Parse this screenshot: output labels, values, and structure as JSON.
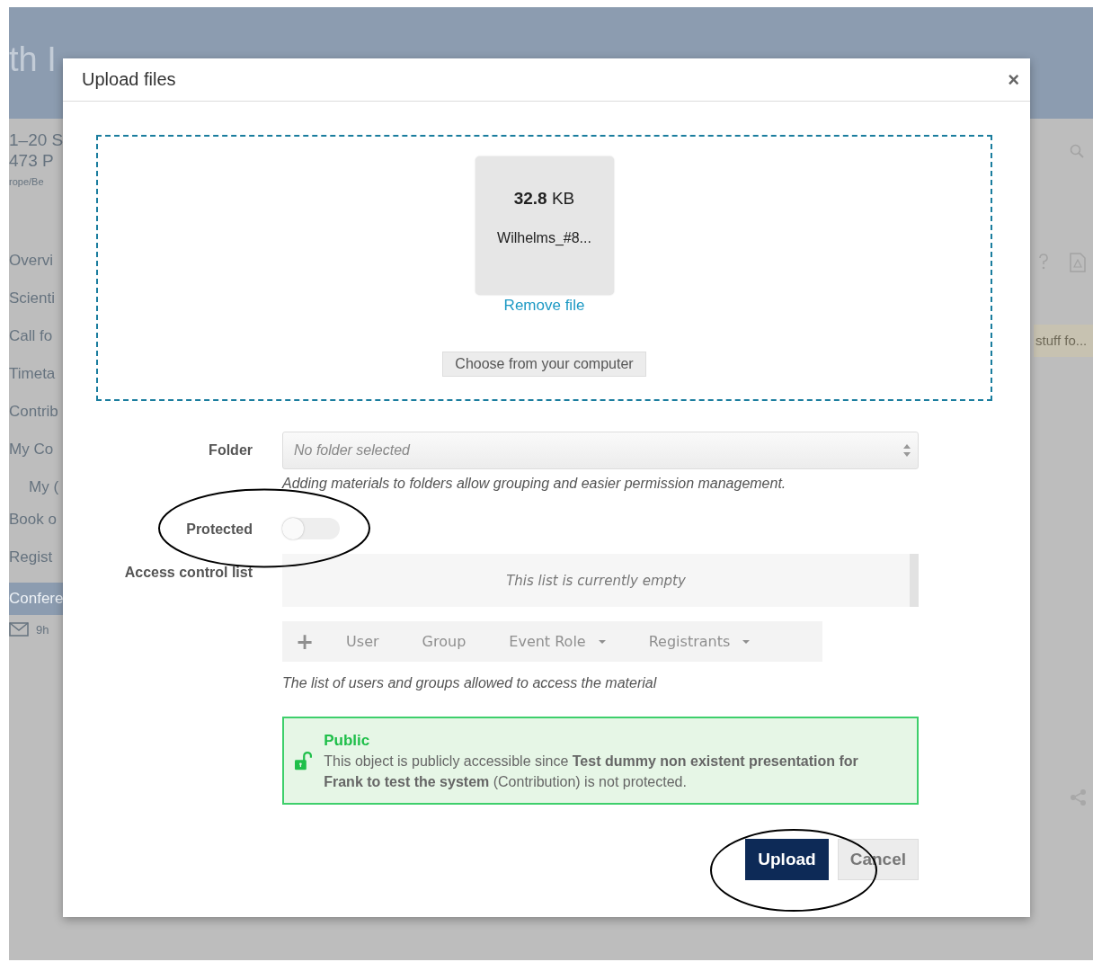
{
  "background_page": {
    "header_title": "th I",
    "info_lines": [
      "1–20 S",
      "473 P"
    ],
    "timezone": "rope/Be",
    "menu": [
      {
        "label": "Overvi",
        "selected": false
      },
      {
        "label": "Scienti",
        "selected": false
      },
      {
        "label": "Call fo",
        "selected": false
      },
      {
        "label": "Timeta",
        "selected": false
      },
      {
        "label": "Contrib",
        "selected": false
      },
      {
        "label": "My Co",
        "selected": false,
        "children": [
          {
            "label": "My (",
            "selected": false
          }
        ]
      },
      {
        "label": "Book o",
        "selected": false
      },
      {
        "label": "Regist",
        "selected": false
      },
      {
        "label": "Confere",
        "selected": true
      }
    ],
    "mail_label": "9h",
    "tag": "stuff fo..."
  },
  "dialog": {
    "title": "Upload files",
    "close": "×",
    "file": {
      "size": "**32.8** KB",
      "name": "Wilhelms_#8...",
      "remove_link": "Remove file"
    },
    "choose_button": "Choose from your computer",
    "folder": {
      "label": "Folder",
      "value": "No folder selected",
      "help": "Adding materials to folders allow grouping and easier permission management."
    },
    "protected": {
      "label": "Protected",
      "on": false
    },
    "acl": {
      "label": "Access control list",
      "empty_text": "This list is currently empty",
      "toolbar": [
        {
          "kind": "add",
          "label": "+"
        },
        {
          "kind": "button",
          "label": "User"
        },
        {
          "kind": "button",
          "label": "Group"
        },
        {
          "kind": "dropdown",
          "label": "Event Role"
        },
        {
          "kind": "dropdown",
          "label": "Registrants"
        }
      ],
      "help": "The list of users and groups allowed to access the material"
    },
    "notice": {
      "title": "Public",
      "text": "This object is publicly accessible since **Test dummy non existent presentation for Frank to test the system** (Contribution) is not protected."
    },
    "buttons": [
      {
        "kind": "primary",
        "label": "Upload"
      },
      {
        "kind": "secondary",
        "label": "Cancel"
      }
    ]
  }
}
